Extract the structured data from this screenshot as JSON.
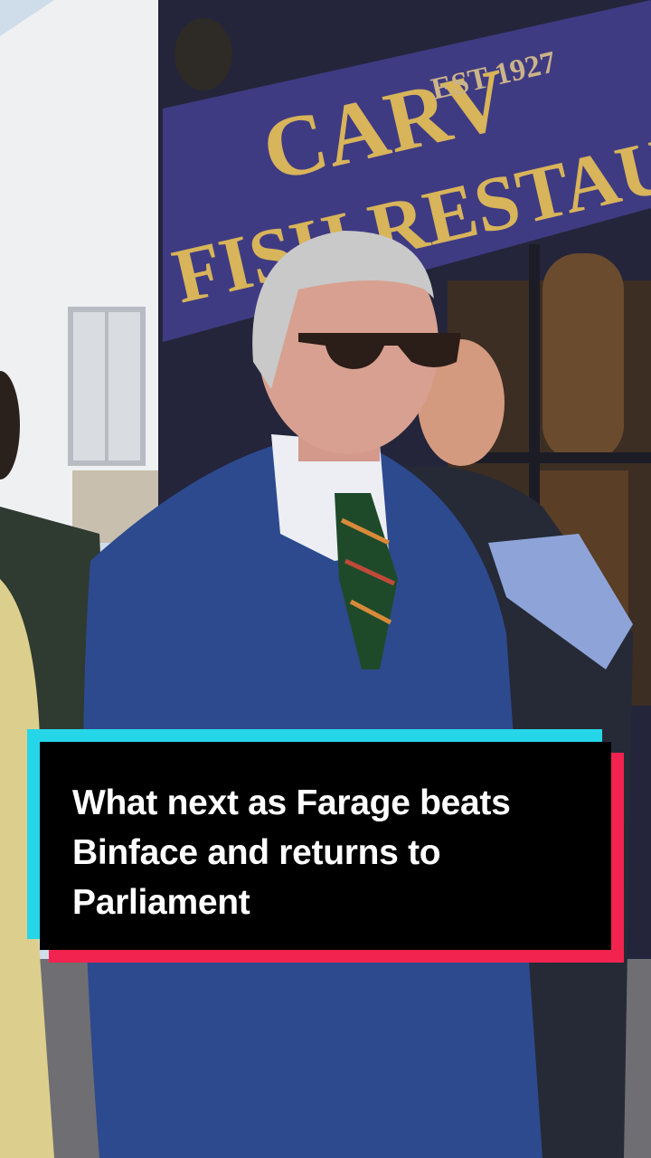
{
  "video": {
    "caption": "What next as Farage beats Binface and returns to Parliament",
    "sign_top": "CARV",
    "sign_est": "EST 1927",
    "sign_bottom": "FISH RESTAU"
  },
  "colors": {
    "caption_bg": "#000000",
    "caption_text": "#ffffff",
    "accent_cyan": "#25d6e9",
    "accent_red": "#f2244f",
    "sign_purple": "#3f3b82",
    "sign_gold": "#d8b45a",
    "suit_blue": "#2d4a8f"
  }
}
